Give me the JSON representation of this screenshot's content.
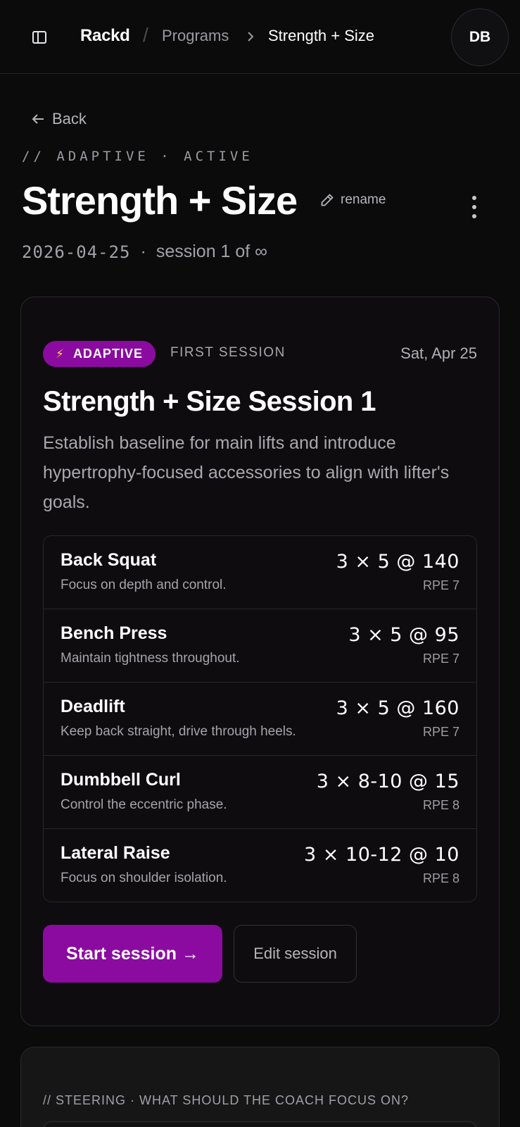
{
  "header": {
    "brand": "Rackd",
    "breadcrumb_sep": "/",
    "breadcrumb_parent": "Programs",
    "breadcrumb_current": "Strength + Size",
    "avatar_initials": "DB"
  },
  "page": {
    "back_label": "Back",
    "eyebrow": "// ADAPTIVE · ACTIVE",
    "title": "Strength + Size",
    "rename_label": "rename",
    "date": "2026-04-25",
    "meta_dot": "·",
    "session_progress": "session 1 of ∞"
  },
  "session": {
    "badge_label": "ADAPTIVE",
    "badge_icon": "⚡",
    "tag": "FIRST SESSION",
    "date": "Sat, Apr 25",
    "title": "Strength + Size Session 1",
    "description": "Establish baseline for main lifts and introduce hypertrophy-focused accessories to align with lifter's goals.",
    "exercises": [
      {
        "name": "Back Squat",
        "note": "Focus on depth and control.",
        "scheme": "3 × 5 @ 140",
        "rpe": "RPE 7"
      },
      {
        "name": "Bench Press",
        "note": "Maintain tightness throughout.",
        "scheme": "3 × 5 @ 95",
        "rpe": "RPE 7"
      },
      {
        "name": "Deadlift",
        "note": "Keep back straight, drive through heels.",
        "scheme": "3 × 5 @ 160",
        "rpe": "RPE 7"
      },
      {
        "name": "Dumbbell Curl",
        "note": "Control the eccentric phase.",
        "scheme": "3 × 8-10 @ 15",
        "rpe": "RPE 8"
      },
      {
        "name": "Lateral Raise",
        "note": "Focus on shoulder isolation.",
        "scheme": "3 × 10-12 @ 10",
        "rpe": "RPE 8"
      }
    ],
    "start_label": "Start session →",
    "edit_label": "Edit session"
  },
  "steering": {
    "label": "// STEERING · WHAT SHOULD THE COACH FOCUS ON?"
  },
  "colors": {
    "accent": "#8b0ba0",
    "background": "#0b0b0c",
    "card": "#0f0c10",
    "bolt": "#ffd13a"
  }
}
